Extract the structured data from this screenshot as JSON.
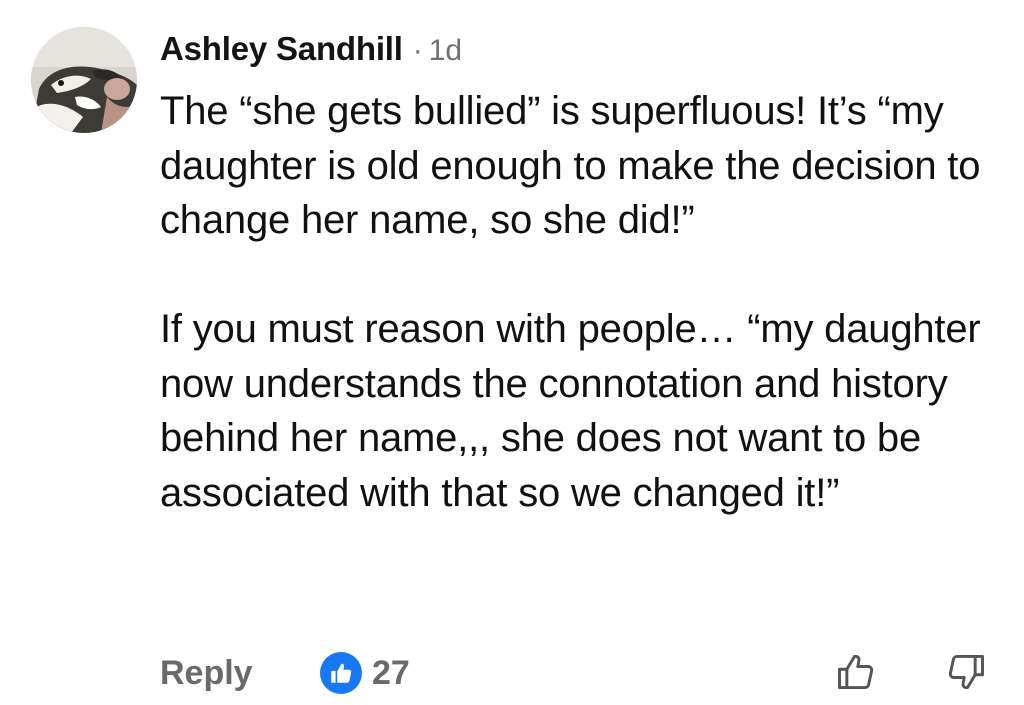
{
  "comment": {
    "author": "Ashley Sandhill",
    "separator": "·",
    "timestamp": "1d",
    "paragraphs": [
      "The “she gets bullied” is superfluous! It’s “my daughter is old enough to make the decision to change her name, so she did!”",
      "If you must reason with people… “my daughter now understands the connotation and history behind her name,,, she does not want to be associated with that so we changed it!”"
    ],
    "avatar_icon": "profile-photo-cat",
    "actions": {
      "reply_label": "Reply",
      "reaction_icon": "thumbs-up-badge-icon",
      "reaction_count": "27",
      "upvote_icon": "thumbs-up-outline-icon",
      "downvote_icon": "thumbs-down-outline-icon"
    },
    "colors": {
      "reaction_blue": "#1877f2",
      "meta_gray": "#707070",
      "text": "#111111"
    }
  }
}
